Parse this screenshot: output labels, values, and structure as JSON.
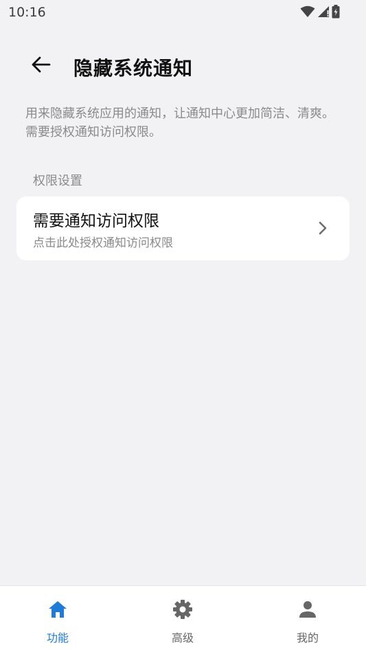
{
  "status_bar": {
    "time": "10:16"
  },
  "header": {
    "title": "隐藏系统通知",
    "back_icon": "arrow-left-icon"
  },
  "description": "用来隐藏系统应用的通知，让通知中心更加简洁、清爽。需要授权通知访问权限。",
  "section": {
    "label": "权限设置"
  },
  "permission_card": {
    "title": "需要通知访问权限",
    "subtitle": "点击此处授权通知访问权限",
    "chevron_icon": "chevron-right-icon"
  },
  "bottom_nav": {
    "items": [
      {
        "label": "功能",
        "icon": "home-icon",
        "active": true
      },
      {
        "label": "高级",
        "icon": "gear-icon",
        "active": false
      },
      {
        "label": "我的",
        "icon": "person-icon",
        "active": false
      }
    ]
  },
  "colors": {
    "background": "#f2f2f4",
    "accent": "#1e7bd8",
    "inactive_icon": "#666666"
  }
}
